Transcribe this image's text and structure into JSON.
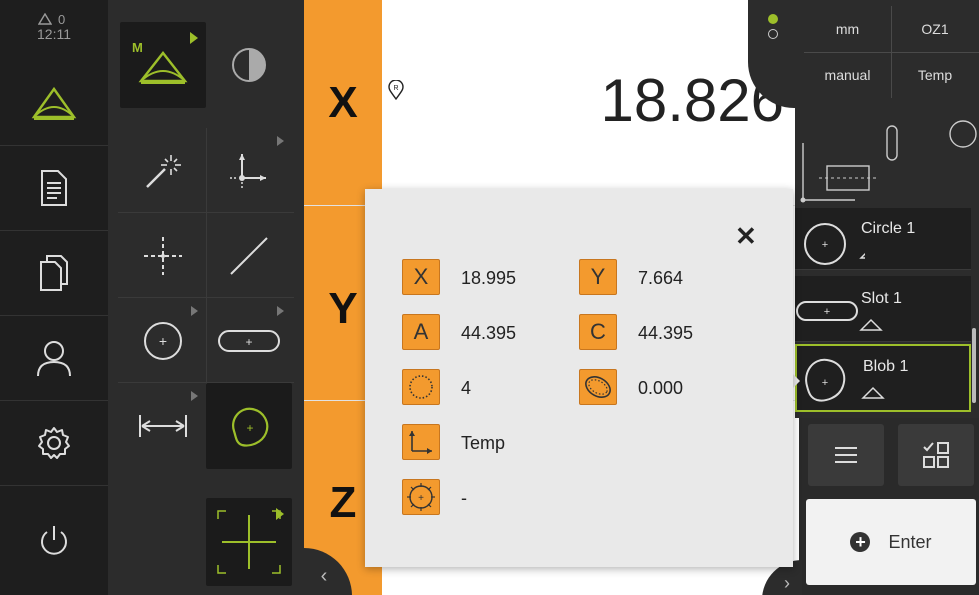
{
  "status": {
    "warning_count": "0",
    "time": "12:11"
  },
  "main_menu": {
    "items": [
      {
        "name": "measure",
        "icon": "measure-icon",
        "active": true
      },
      {
        "name": "measurement-report",
        "icon": "report-icon"
      },
      {
        "name": "file-management",
        "icon": "file-management-icon"
      },
      {
        "name": "user-login",
        "icon": "user-icon"
      },
      {
        "name": "settings",
        "icon": "settings-icon"
      },
      {
        "name": "switch-off",
        "icon": "power-icon"
      }
    ]
  },
  "palette": {
    "measure_mode_badge": "M",
    "tools": [
      {
        "name": "manual-measurement",
        "icon": "manual-measurement-icon"
      },
      {
        "name": "contrast",
        "icon": "contrast-icon"
      },
      {
        "name": "auto-point",
        "icon": "magic-wand-icon"
      },
      {
        "name": "reference-system",
        "icon": "reference-system-icon"
      },
      {
        "name": "point",
        "icon": "point-icon"
      },
      {
        "name": "line",
        "icon": "line-icon"
      },
      {
        "name": "circle",
        "icon": "circle-icon"
      },
      {
        "name": "slot",
        "icon": "slot-icon"
      },
      {
        "name": "distance",
        "icon": "distance-icon"
      },
      {
        "name": "blob",
        "icon": "blob-icon"
      },
      {
        "name": "crosshair",
        "icon": "crosshair-icon"
      }
    ]
  },
  "position_display": {
    "axes": [
      "X",
      "Y",
      "Z"
    ],
    "x_value": "18.826"
  },
  "status_bar": {
    "unit": "mm",
    "operator": "OZ1",
    "mode": "manual",
    "reference": "Temp",
    "led_colors": [
      "#9dbf2a",
      "#2c2c2c"
    ]
  },
  "features": [
    {
      "name": "Circle 1",
      "icon": "circle-icon"
    },
    {
      "name": "Slot 1",
      "icon": "slot-icon"
    },
    {
      "name": "Blob 1",
      "icon": "blob-icon",
      "selected": true
    }
  ],
  "buttons": {
    "list_icon": "list-icon",
    "checklist_icon": "checklist-icon",
    "enter_label": "Enter"
  },
  "popup": {
    "close": "✕",
    "fields": [
      {
        "badge": "X",
        "value": "18.995"
      },
      {
        "badge": "Y",
        "value": "7.664"
      },
      {
        "badge": "A",
        "value": "44.395"
      },
      {
        "badge": "C",
        "value": "44.395"
      },
      {
        "badge_icon": "points-count-icon",
        "value": "4"
      },
      {
        "badge_icon": "form-error-icon",
        "value": "0.000"
      },
      {
        "badge_icon": "reference-system-icon",
        "value": "Temp"
      },
      {
        "badge_icon": "fit-method-icon",
        "value": "-"
      }
    ]
  },
  "colors": {
    "accent_orange": "#f39a2e",
    "accent_green": "#9dbf2a"
  }
}
